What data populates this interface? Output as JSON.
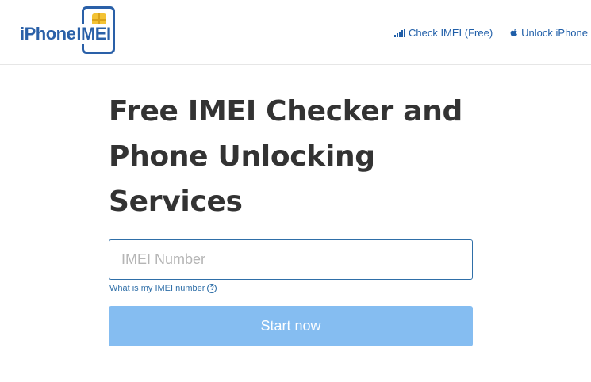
{
  "header": {
    "logo": {
      "text_prefix": "iPhone",
      "text_suffix": "IMEI"
    },
    "nav": [
      {
        "label": "Check IMEI (Free)",
        "icon": "signal-bars-icon"
      },
      {
        "label": "Unlock iPhone",
        "icon": "apple-icon"
      }
    ]
  },
  "main": {
    "title": "Free IMEI Checker and Phone Unlocking Services",
    "imei_input": {
      "placeholder": "IMEI Number",
      "value": ""
    },
    "help_link": "What is my IMEI number",
    "start_button": "Start now"
  },
  "colors": {
    "brand_blue": "#2a60a8",
    "link_blue": "#1f5ea8",
    "button_bg": "#85bdf1",
    "chip_gold": "#f3c234"
  }
}
